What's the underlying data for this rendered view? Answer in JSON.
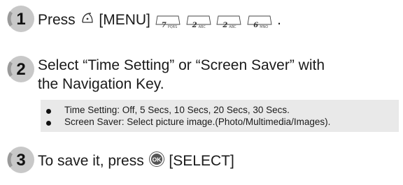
{
  "steps": [
    {
      "number": "1",
      "prefix": "Press",
      "menu_label": "[MENU]",
      "keys": [
        {
          "glyph": "7",
          "sub": "PQRS"
        },
        {
          "glyph": "2",
          "sub": "ABC"
        },
        {
          "glyph": "2",
          "sub": "ABC"
        },
        {
          "glyph": "6",
          "sub": "MNO"
        }
      ],
      "suffix": "."
    },
    {
      "number": "2",
      "line1": "Select “Time Setting” or “Screen Saver” with",
      "line2": "the Navigation Key."
    },
    {
      "number": "3",
      "prefix": "To save it, press",
      "ok_label": "OK",
      "select_label": "[SELECT]"
    }
  ],
  "notes": [
    "Time Setting: Off, 5 Secs, 10 Secs, 20 Secs, 30 Secs.",
    "Screen Saver: Select picture image.(Photo/Multimedia/Images)."
  ],
  "icons": {
    "step_badge": "step-number-badge",
    "menu": "menu-softkey-icon",
    "keypad": "keypad-key-icon",
    "ok": "ok-button-icon"
  },
  "colors": {
    "badge_fill": "#c8c8c8",
    "note_background": "#e9e9e9"
  }
}
